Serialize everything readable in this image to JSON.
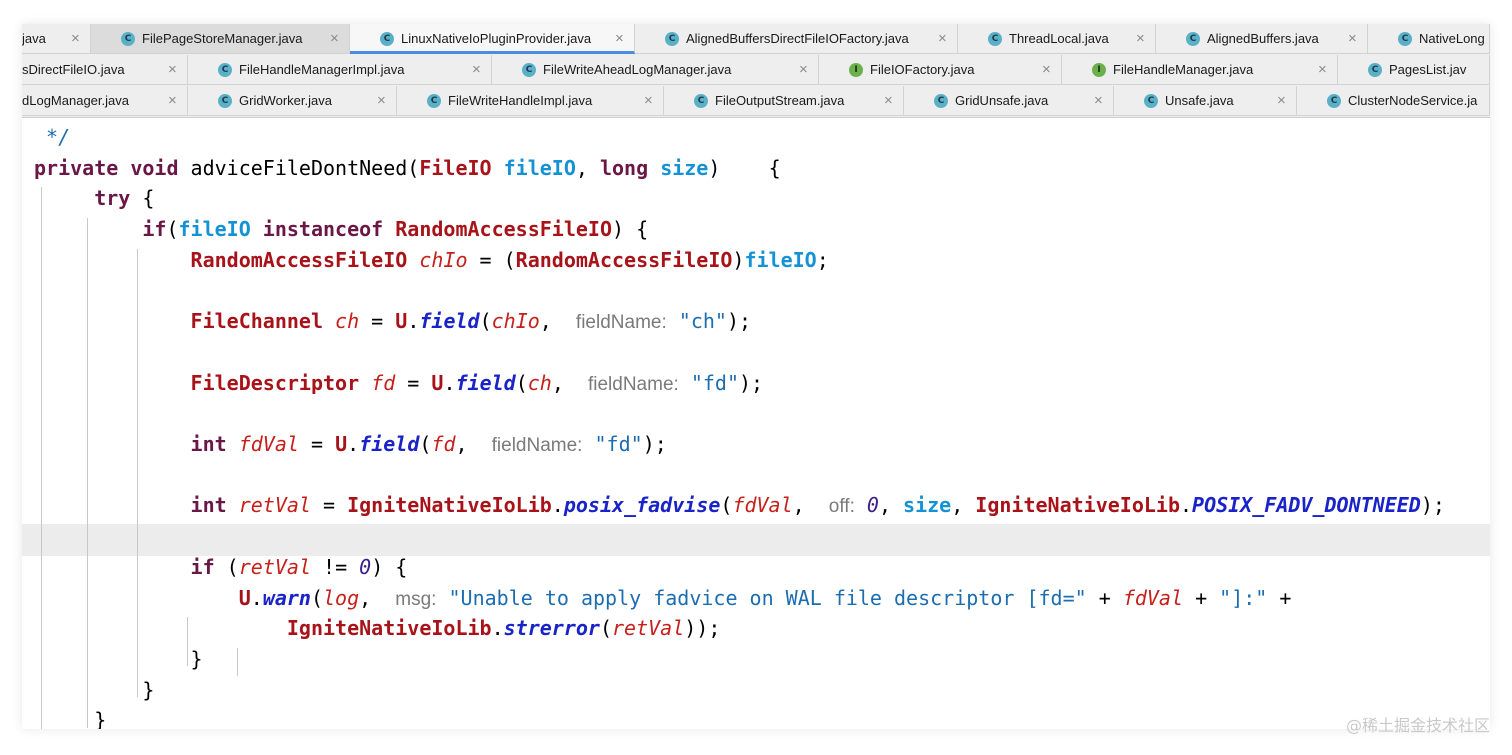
{
  "tab_rows": [
    [
      {
        "label": "java",
        "icon": "",
        "icon_letter": "",
        "state": "normal"
      },
      {
        "label": "FilePageStoreManager.java",
        "icon": "class",
        "icon_letter": "C",
        "state": "active"
      },
      {
        "label": "LinuxNativeIoPluginProvider.java",
        "icon": "class",
        "icon_letter": "C",
        "state": "current"
      },
      {
        "label": "AlignedBuffersDirectFileIOFactory.java",
        "icon": "class",
        "icon_letter": "C",
        "state": "normal"
      },
      {
        "label": "ThreadLocal.java",
        "icon": "class",
        "icon_letter": "C",
        "state": "normal"
      },
      {
        "label": "AlignedBuffers.java",
        "icon": "class",
        "icon_letter": "C",
        "state": "normal"
      },
      {
        "label": "NativeLong",
        "icon": "class",
        "icon_letter": "C",
        "state": "normal"
      }
    ],
    [
      {
        "label": "sDirectFileIO.java",
        "icon": "",
        "icon_letter": "",
        "state": "normal"
      },
      {
        "label": "FileHandleManagerImpl.java",
        "icon": "class",
        "icon_letter": "C",
        "state": "normal"
      },
      {
        "label": "FileWriteAheadLogManager.java",
        "icon": "class",
        "icon_letter": "C",
        "state": "normal"
      },
      {
        "label": "FileIOFactory.java",
        "icon": "interface",
        "icon_letter": "I",
        "state": "normal"
      },
      {
        "label": "FileHandleManager.java",
        "icon": "interface",
        "icon_letter": "I",
        "state": "normal"
      },
      {
        "label": "PagesList.jav",
        "icon": "class",
        "icon_letter": "C",
        "state": "normal"
      }
    ],
    [
      {
        "label": "dLogManager.java",
        "icon": "",
        "icon_letter": "",
        "state": "normal"
      },
      {
        "label": "GridWorker.java",
        "icon": "class",
        "icon_letter": "C",
        "state": "normal"
      },
      {
        "label": "FileWriteHandleImpl.java",
        "icon": "class",
        "icon_letter": "C",
        "state": "normal"
      },
      {
        "label": "FileOutputStream.java",
        "icon": "class",
        "icon_letter": "C",
        "state": "normal"
      },
      {
        "label": "GridUnsafe.java",
        "icon": "class",
        "icon_letter": "C",
        "state": "normal"
      },
      {
        "label": "Unsafe.java",
        "icon": "class",
        "icon_letter": "C",
        "state": "normal"
      },
      {
        "label": "ClusterNodeService.ja",
        "icon": "class",
        "icon_letter": "C",
        "state": "normal"
      }
    ]
  ],
  "tab_close_glyph": "×",
  "code_lines": [
    [
      [
        "cmt",
        " */"
      ]
    ],
    [
      [
        "kw",
        "private void "
      ],
      [
        "",
        "adviceFileDontNeed("
      ],
      [
        "cls",
        "FileIO "
      ],
      [
        "fld",
        "fileIO"
      ],
      [
        "",
        ", "
      ],
      [
        "kw",
        "long "
      ],
      [
        "fld",
        "size"
      ],
      [
        "",
        ")    {"
      ]
    ],
    [
      [
        "",
        "     "
      ],
      [
        "kw",
        "try"
      ],
      [
        "",
        " {"
      ]
    ],
    [
      [
        "",
        "         "
      ],
      [
        "kw",
        "if"
      ],
      [
        "",
        "("
      ],
      [
        "fld",
        "fileIO"
      ],
      [
        "kw",
        " instanceof "
      ],
      [
        "cls",
        "RandomAccessFileIO"
      ],
      [
        "",
        ") {"
      ]
    ],
    [
      [
        "",
        "             "
      ],
      [
        "cls",
        "RandomAccessFileIO "
      ],
      [
        "var",
        "chIo"
      ],
      [
        "",
        " = ("
      ],
      [
        "cls",
        "RandomAccessFileIO"
      ],
      [
        "",
        ")"
      ],
      [
        "fld",
        "fileIO"
      ],
      [
        "",
        ";"
      ]
    ],
    [],
    [
      [
        "",
        "             "
      ],
      [
        "cls",
        "FileChannel "
      ],
      [
        "var",
        "ch"
      ],
      [
        "",
        " = "
      ],
      [
        "cls",
        "U"
      ],
      [
        "",
        "."
      ],
      [
        "meth",
        "field"
      ],
      [
        "",
        "("
      ],
      [
        "var",
        "chIo"
      ],
      [
        "",
        ",  "
      ],
      [
        "hint",
        "fieldName:"
      ],
      [
        "",
        " "
      ],
      [
        "str",
        "\"ch\""
      ],
      [
        "",
        ");"
      ]
    ],
    [],
    [
      [
        "",
        "             "
      ],
      [
        "cls",
        "FileDescriptor "
      ],
      [
        "var",
        "fd"
      ],
      [
        "",
        " = "
      ],
      [
        "cls",
        "U"
      ],
      [
        "",
        "."
      ],
      [
        "meth",
        "field"
      ],
      [
        "",
        "("
      ],
      [
        "var",
        "ch"
      ],
      [
        "",
        ",  "
      ],
      [
        "hint",
        "fieldName:"
      ],
      [
        "",
        " "
      ],
      [
        "str",
        "\"fd\""
      ],
      [
        "",
        ");"
      ]
    ],
    [],
    [
      [
        "",
        "             "
      ],
      [
        "kw",
        "int "
      ],
      [
        "var",
        "fdVal"
      ],
      [
        "",
        " = "
      ],
      [
        "cls",
        "U"
      ],
      [
        "",
        "."
      ],
      [
        "meth",
        "field"
      ],
      [
        "",
        "("
      ],
      [
        "var",
        "fd"
      ],
      [
        "",
        ",  "
      ],
      [
        "hint",
        "fieldName:"
      ],
      [
        "",
        " "
      ],
      [
        "str",
        "\"fd\""
      ],
      [
        "",
        ");"
      ]
    ],
    [],
    [
      [
        "",
        "             "
      ],
      [
        "kw",
        "int "
      ],
      [
        "var",
        "retVal"
      ],
      [
        "",
        " = "
      ],
      [
        "cls",
        "IgniteNativeIoLib"
      ],
      [
        "",
        "."
      ],
      [
        "meth",
        "posix_fadvise"
      ],
      [
        "",
        "("
      ],
      [
        "var",
        "fdVal"
      ],
      [
        "",
        ",  "
      ],
      [
        "hint",
        "off:"
      ],
      [
        "",
        " "
      ],
      [
        "num",
        "0"
      ],
      [
        "",
        ", "
      ],
      [
        "fld",
        "size"
      ],
      [
        "",
        ", "
      ],
      [
        "cls",
        "IgniteNativeIoLib"
      ],
      [
        "",
        "."
      ],
      [
        "const",
        "POSIX_FADV_DONTNEED"
      ],
      [
        "",
        ");"
      ]
    ],
    [],
    [
      [
        "",
        "             "
      ],
      [
        "kw",
        "if"
      ],
      [
        "",
        " ("
      ],
      [
        "var",
        "retVal"
      ],
      [
        "",
        " != "
      ],
      [
        "num",
        "0"
      ],
      [
        "",
        ") {"
      ]
    ],
    [
      [
        "",
        "                 "
      ],
      [
        "cls",
        "U"
      ],
      [
        "",
        "."
      ],
      [
        "meth",
        "warn"
      ],
      [
        "",
        "("
      ],
      [
        "var",
        "log"
      ],
      [
        "",
        ",  "
      ],
      [
        "hint",
        "msg:"
      ],
      [
        "",
        " "
      ],
      [
        "str",
        "\"Unable to apply fadvice on WAL file descriptor [fd=\""
      ],
      [
        "",
        " + "
      ],
      [
        "var",
        "fdVal"
      ],
      [
        "",
        " + "
      ],
      [
        "str",
        "\"]:\""
      ],
      [
        "",
        " +"
      ]
    ],
    [
      [
        "",
        "                     "
      ],
      [
        "cls",
        "IgniteNativeIoLib"
      ],
      [
        "",
        "."
      ],
      [
        "meth",
        "strerror"
      ],
      [
        "",
        "("
      ],
      [
        "var",
        "retVal"
      ],
      [
        "",
        "));"
      ]
    ],
    [
      [
        "",
        "             }"
      ]
    ],
    [
      [
        "",
        "         }"
      ]
    ],
    [
      [
        "",
        "     }"
      ]
    ]
  ],
  "watermark": "@稀土掘金技术社区"
}
